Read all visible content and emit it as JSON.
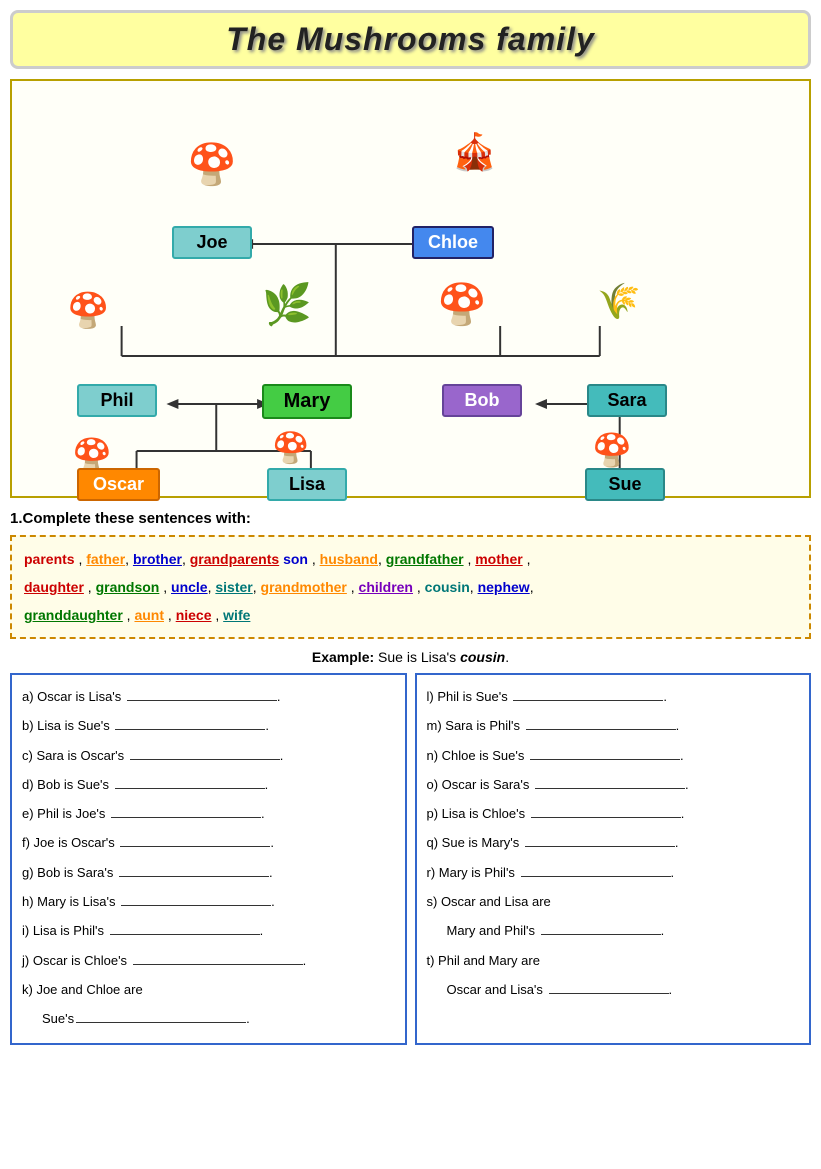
{
  "title": "The Mushrooms family",
  "family_tree": {
    "generation1": [
      {
        "name": "Joe",
        "style": "teal"
      },
      {
        "name": "Chloe",
        "style": "blue"
      }
    ],
    "generation2": [
      {
        "name": "Phil",
        "style": "teal"
      },
      {
        "name": "Mary",
        "style": "green"
      },
      {
        "name": "Bob",
        "style": "purple"
      },
      {
        "name": "Sara",
        "style": "teal2"
      }
    ],
    "generation3": [
      {
        "name": "Oscar",
        "style": "orange"
      },
      {
        "name": "Lisa",
        "style": "teal"
      },
      {
        "name": "Sue",
        "style": "teal2"
      }
    ]
  },
  "section1": {
    "title": "1.Complete these sentences with:",
    "words": "parents , father, brother, grandparents son , husband, grandfather , mother , daughter , grandson , uncle, sister, grandmother , children , cousin, nephew, granddaughter , aunt , niece , wife"
  },
  "example": {
    "label": "Example:",
    "text": "Sue is Lisa's",
    "answer": "cousin"
  },
  "questions_left": [
    {
      "id": "a",
      "text": "Oscar is Lisa's"
    },
    {
      "id": "b",
      "text": "Lisa is Sue's"
    },
    {
      "id": "c",
      "text": "Sara is Oscar's"
    },
    {
      "id": "d",
      "text": "Bob is Sue's"
    },
    {
      "id": "e",
      "text": "Phil is Joe's"
    },
    {
      "id": "f",
      "text": "Joe is Oscar's"
    },
    {
      "id": "g",
      "text": "Bob is Sara's"
    },
    {
      "id": "h",
      "text": "Mary is Lisa's"
    },
    {
      "id": "i",
      "text": "Lisa is Phil's"
    },
    {
      "id": "j",
      "text": "Oscar is Chloe's"
    },
    {
      "id": "k_line1",
      "text": "Joe and Chloe are"
    },
    {
      "id": "k_line2",
      "text": "Sue's"
    }
  ],
  "questions_right": [
    {
      "id": "l",
      "text": "Phil is Sue's"
    },
    {
      "id": "m",
      "text": "Sara is Phil's"
    },
    {
      "id": "n",
      "text": "Chloe is Sue's"
    },
    {
      "id": "o",
      "text": "Oscar is Sara's"
    },
    {
      "id": "p",
      "text": "Lisa is Chloe's"
    },
    {
      "id": "q",
      "text": "Sue is Mary's"
    },
    {
      "id": "r",
      "text": "Mary is Phil's"
    },
    {
      "id": "s_line1",
      "text": "Oscar and Lisa are"
    },
    {
      "id": "s_line2",
      "text": "Mary and Phil's"
    },
    {
      "id": "t_line1",
      "text": "Phil and Mary are"
    },
    {
      "id": "t_line2",
      "text": "Oscar and Lisa's"
    }
  ]
}
